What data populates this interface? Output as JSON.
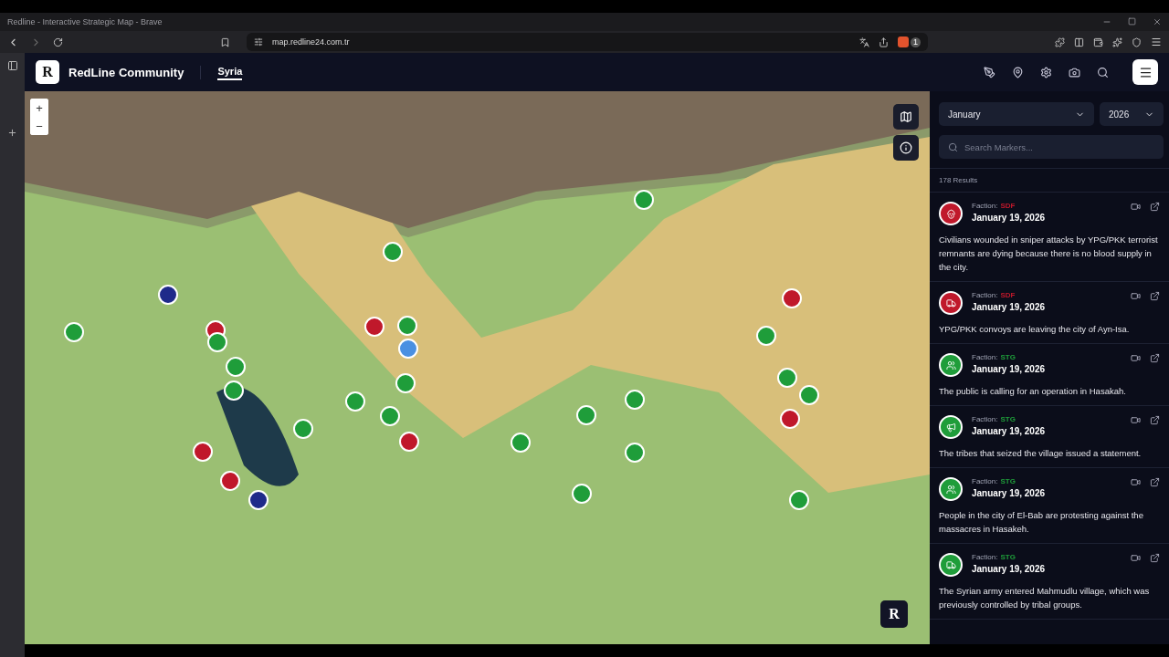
{
  "window": {
    "title": "Redline - Interactive Strategic Map - Brave"
  },
  "browser": {
    "url": "map.redline24.com.tr",
    "shield_count": "1"
  },
  "app": {
    "logo_letter": "R",
    "name": "RedLine Community",
    "tabs": [
      {
        "label": "Syria",
        "selected": true
      }
    ]
  },
  "map": {
    "zoom_in": "+",
    "zoom_out": "−",
    "badge_letter": "R",
    "markers": [
      {
        "color": "#1f9d3a"
      },
      {
        "color": "#1f9d3a"
      },
      {
        "color": "#c0182b"
      },
      {
        "color": "#1f9d3a"
      },
      {
        "color": "#1f2a8a"
      },
      {
        "color": "#1f9d3a"
      },
      {
        "color": "#c0182b"
      },
      {
        "color": "#1f9d3a"
      },
      {
        "color": "#c0182b"
      },
      {
        "color": "#1f9d3a"
      },
      {
        "color": "#4a90e2"
      },
      {
        "color": "#1f9d3a"
      },
      {
        "color": "#1f9d3a"
      },
      {
        "color": "#c0182b"
      },
      {
        "color": "#1f9d3a"
      },
      {
        "color": "#1f9d3a"
      },
      {
        "color": "#1f9d3a"
      },
      {
        "color": "#c0182b"
      },
      {
        "color": "#1f9d3a"
      },
      {
        "color": "#1f9d3a"
      },
      {
        "color": "#1f9d3a"
      },
      {
        "color": "#1f9d3a"
      },
      {
        "color": "#1f9d3a"
      },
      {
        "color": "#1f9d3a"
      },
      {
        "color": "#c0182b"
      },
      {
        "color": "#1f9d3a"
      },
      {
        "color": "#1f2a8a"
      },
      {
        "color": "#1f9d3a"
      },
      {
        "color": "#c0182b"
      },
      {
        "color": "#1f9d3a"
      }
    ]
  },
  "filters": {
    "month": "January",
    "year": "2026",
    "search_placeholder": "Search Markers...",
    "results": "178 Results"
  },
  "feed": [
    {
      "kind": "skull",
      "color": "#c0182b",
      "faction_label": "Faction:",
      "faction": "SDF",
      "date": "January 19, 2026",
      "text": "Civilians wounded in sniper attacks by YPG/PKK terrorist remnants are dying because there is no blood supply in the city."
    },
    {
      "kind": "truck",
      "color": "#c0182b",
      "faction_label": "Faction:",
      "faction": "SDF",
      "date": "January 19, 2026",
      "text": "YPG/PKK convoys are leaving the city of Ayn-Isa."
    },
    {
      "kind": "people",
      "color": "#1f9d3a",
      "faction_label": "Faction:",
      "faction": "STG",
      "date": "January 19, 2026",
      "text": "The public is calling for an operation in Hasakah."
    },
    {
      "kind": "megaphone",
      "color": "#1f9d3a",
      "faction_label": "Faction:",
      "faction": "STG",
      "date": "January 19, 2026",
      "text": "The tribes that seized the village issued a statement."
    },
    {
      "kind": "people",
      "color": "#1f9d3a",
      "faction_label": "Faction:",
      "faction": "STG",
      "date": "January 19, 2026",
      "text": "People in the city of El-Bab are protesting against the massacres in Hasakeh."
    },
    {
      "kind": "truck",
      "color": "#1f9d3a",
      "faction_label": "Faction:",
      "faction": "STG",
      "date": "January 19, 2026",
      "text": "The Syrian army entered Mahmudlu village, which was previously controlled by tribal groups."
    }
  ]
}
